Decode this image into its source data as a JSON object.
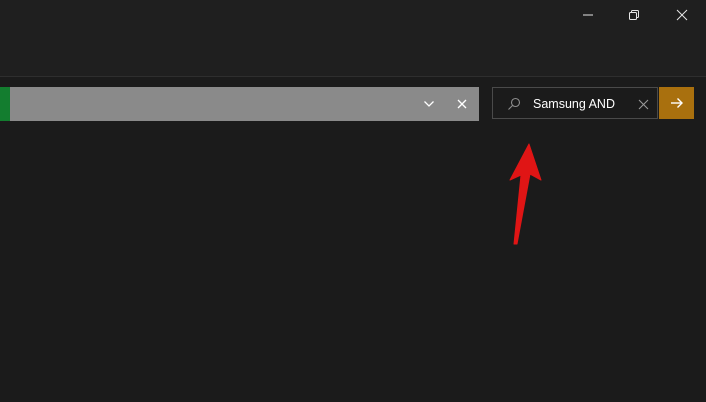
{
  "window": {
    "controls": {
      "minimize_icon": "minimize-icon",
      "restore_icon": "restore-icon",
      "close_icon": "close-icon"
    }
  },
  "filter_bar": {
    "accent_color": "#137d2f",
    "background_color": "#8a8a8a",
    "dropdown_icon": "chevron-down-icon",
    "clear_icon": "close-icon"
  },
  "search": {
    "value": "Samsung AND",
    "placeholder": "",
    "icon": "search-icon",
    "clear_icon": "close-icon",
    "submit_icon": "arrow-right-icon",
    "submit_color": "#a9700e"
  },
  "annotation": {
    "arrow_color": "#e01515",
    "icon": "arrow-up-annotation"
  }
}
